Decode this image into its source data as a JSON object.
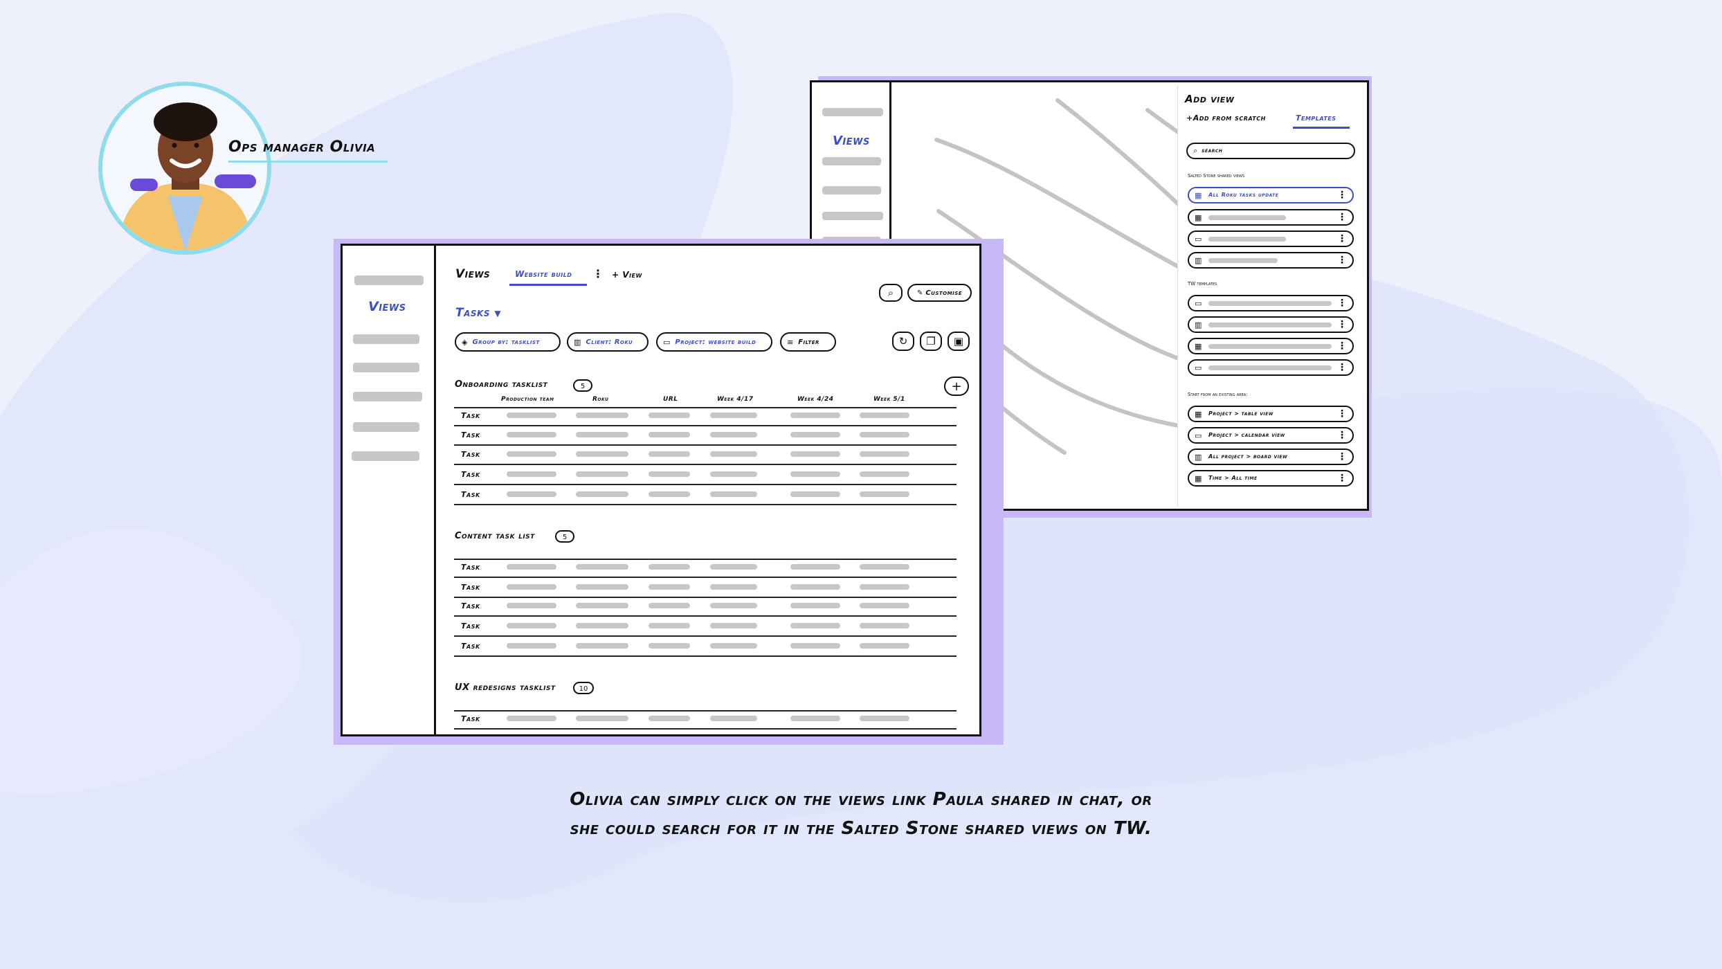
{
  "persona": {
    "label": "Ops manager Olivia"
  },
  "back_window": {
    "sidebar_label": "Views",
    "panel": {
      "title": "Add view",
      "tab_scratch": "+Add from scratch",
      "tab_templates": "Templates",
      "search_placeholder": "search",
      "section_shared": "Salted Stone shared views",
      "shared_first": "All Roku tasks update",
      "section_tw": "TW templates",
      "section_existing": "Start from an existing area:",
      "existing": [
        "Project > table view",
        "Project > calendar view",
        "All project > board view",
        "Time > All time"
      ]
    }
  },
  "front_window": {
    "sidebar_label": "Views",
    "header": {
      "views": "Views",
      "active_tab": "Website build",
      "more": "⋮",
      "add_view": "+ View"
    },
    "customise": "Customise",
    "tasks_dropdown": "Tasks",
    "filters": {
      "group_by": "Group by: tasklist",
      "client": "Client: Roku",
      "project": "Project: website build",
      "filter": "Filter"
    },
    "sections": [
      {
        "title": "Onboarding tasklist",
        "count": "5"
      },
      {
        "title": "Content task list",
        "count": "5"
      },
      {
        "title": "UX redesigns tasklist",
        "count": "10"
      }
    ],
    "columns": [
      "Production team",
      "Roku",
      "URL",
      "Week 4/17",
      "Week 4/24",
      "Week 5/1"
    ],
    "task_label": "Task"
  },
  "caption": {
    "line1": "Olivia can simply click on the views link Paula shared in chat, or",
    "line2": "she could search for it in the Salted Stone shared views on TW."
  },
  "colors": {
    "background": "#eef1fc",
    "blob": "#dfe5fa",
    "accent_blue": "#3d4fc4",
    "shadow_purple": "#c8b8f7",
    "avatar_ring": "#8fdceb"
  }
}
